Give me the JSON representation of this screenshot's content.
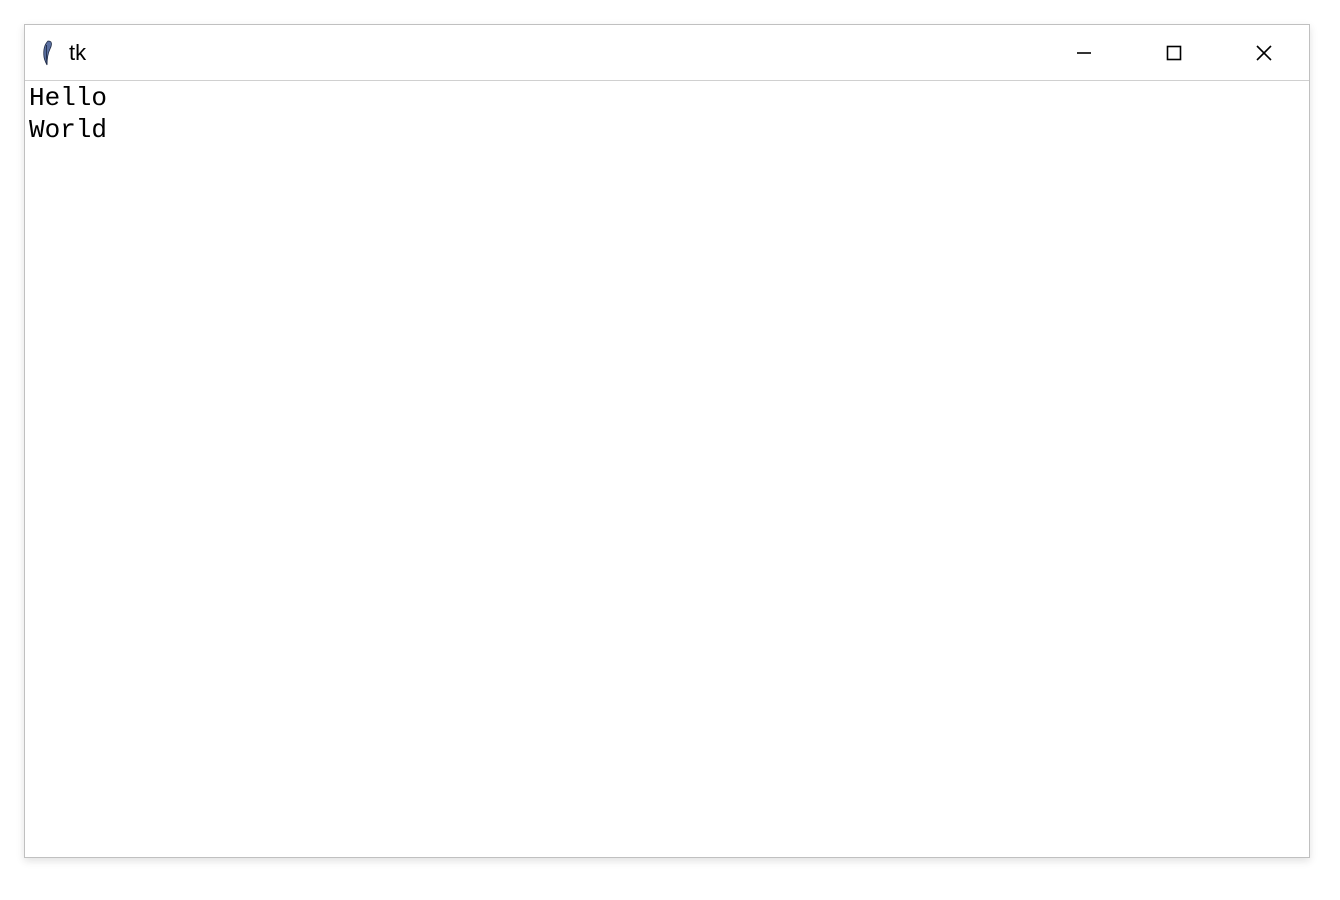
{
  "window": {
    "title": "tk",
    "controls": {
      "minimize": "minimize",
      "maximize": "maximize",
      "close": "close"
    }
  },
  "content": {
    "lines": [
      "Hello",
      "World"
    ],
    "text": "Hello\nWorld"
  }
}
